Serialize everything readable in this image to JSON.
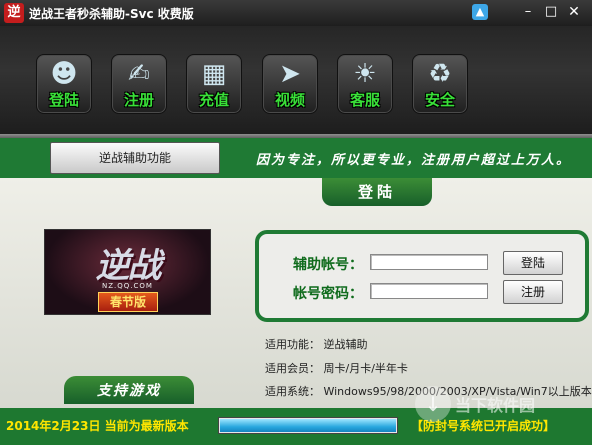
{
  "window": {
    "app_icon": "逆",
    "title": "逆战王者秒杀辅助-Svc 收费版",
    "controls": [
      "shirt-icon",
      "minimize-icon",
      "maximize-icon",
      "close-icon"
    ]
  },
  "toolbar": {
    "items": [
      {
        "label": "登陆",
        "icon": "users-icon"
      },
      {
        "label": "注册",
        "icon": "register-icon"
      },
      {
        "label": "充值",
        "icon": "card-icon"
      },
      {
        "label": "视频",
        "icon": "video-icon"
      },
      {
        "label": "客服",
        "icon": "support-icon"
      },
      {
        "label": "安全",
        "icon": "shield-icon"
      }
    ]
  },
  "band": {
    "function_button": "逆战辅助功能",
    "slogan": "因为专注，所以更专业，注册用户超过上万人。"
  },
  "login": {
    "tab_label": "登陆",
    "account_label": "辅助帐号：",
    "password_label": "帐号密码：",
    "account_value": "",
    "password_value": "",
    "login_button": "登陆",
    "register_button": "注册"
  },
  "banner": {
    "title": "逆战",
    "sub": "NZ.QQ.COM",
    "tag": "春节版"
  },
  "info": {
    "function_line": "适用功能：  逆战辅助",
    "member_line": "适用会员：  周卡/月卡/半年卡",
    "system_line": "适用系统：  Windows95/98/2000/2003/XP/Vista/Win7以上版本"
  },
  "support_tab": "支持游戏",
  "status": {
    "date_text": "2014年2月23日  当前为最新版本",
    "progress": 1.0,
    "tip": "【防封号系统已开启成功】",
    "watermark": "当下软件园"
  },
  "colors": {
    "accent_green": "#1f7a34",
    "label_green": "#39e038",
    "status_yellow": "#ffe600",
    "progress_blue": "#29a8df"
  }
}
